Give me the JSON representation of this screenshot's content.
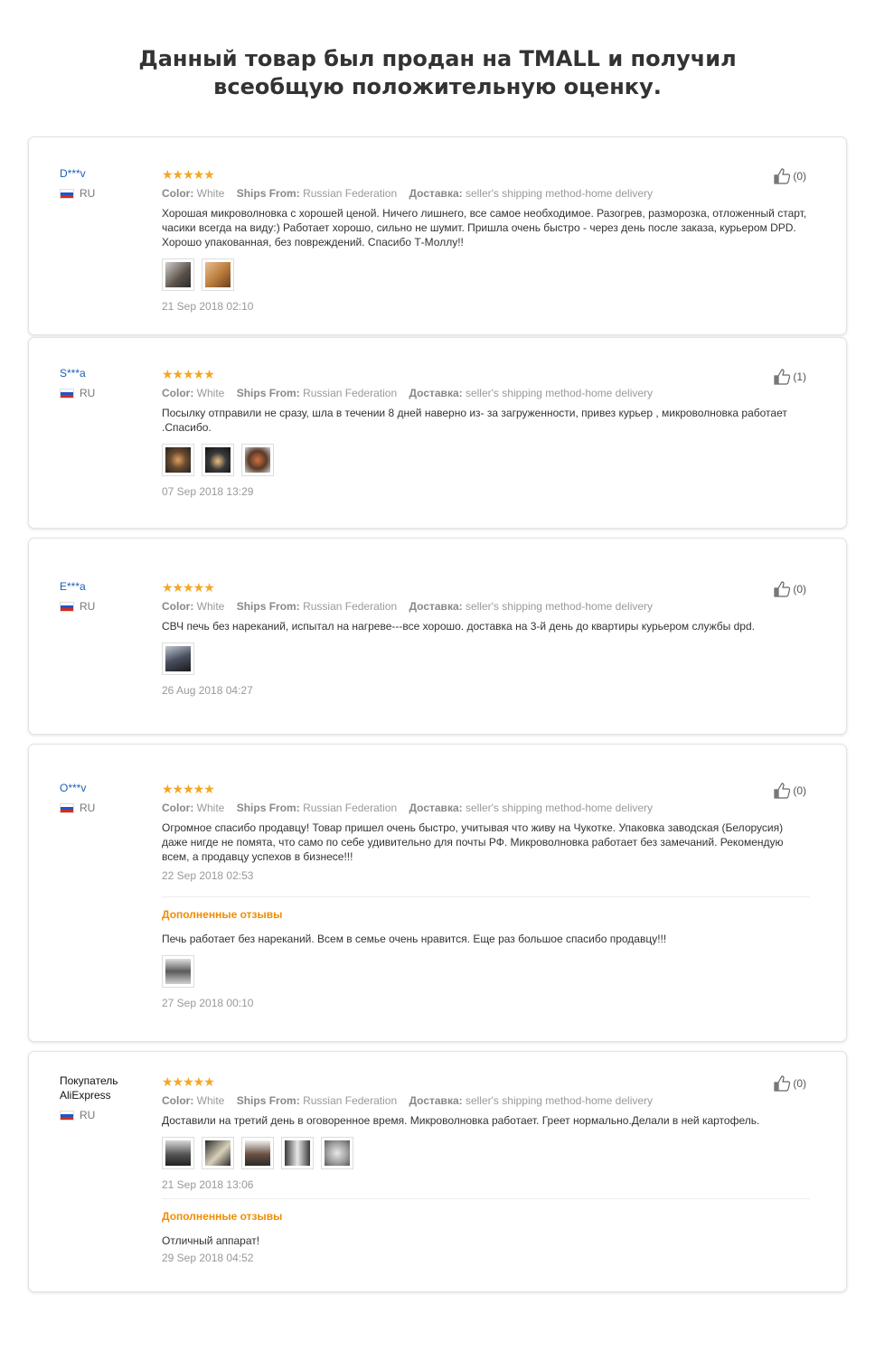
{
  "header": {
    "line1": "Данный товар был продан на TMALL и получил",
    "line2": "всеобщую положительную оценку."
  },
  "labels": {
    "color": "Color:",
    "ships_from": "Ships From:",
    "delivery": "Доставка:",
    "additional": "Дополненные отзывы"
  },
  "colors": {
    "stars": "#f5a623",
    "username": "#1a5fb4",
    "additional": "#f08c00"
  },
  "reviews": [
    {
      "user": "D***v",
      "country": "RU",
      "stars": "★★★★★",
      "rating": 5,
      "color": "White",
      "ships_from": "Russian Federation",
      "delivery": "seller's shipping method-home delivery",
      "text": "Хорошая микроволновка с хорошей ценой. Ничего лишнего, все самое необходимое. Разогрев, разморозка, отложенный старт, часики всегда на виду:) Работает хорошо, сильно не шумит. Пришла очень быстро - через день после заказа, курьером DPD. Хорошо упакованная, без повреждений. Спасибо Т-Моллу!!",
      "photos": [
        "#5a5048",
        "#b87a3a"
      ],
      "date": "21 Sep 2018 02:10",
      "likes": "(0)"
    },
    {
      "user": "S***a",
      "country": "RU",
      "stars": "★★★★★",
      "rating": 5,
      "color": "White",
      "ships_from": "Russian Federation",
      "delivery": "seller's shipping method-home delivery",
      "text": "Посылку отправили не сразу, шла в течении 8 дней наверно из- за загруженности, привез курьер , микроволновка работает .Спасибо.",
      "photos": [
        "#6a4a30",
        "#3a3a3a",
        "#5a3a28"
      ],
      "date": "07 Sep 2018 13:29",
      "likes": "(1)"
    },
    {
      "user": "E***a",
      "country": "RU",
      "stars": "★★★★★",
      "rating": 5,
      "color": "White",
      "ships_from": "Russian Federation",
      "delivery": "seller's shipping method-home delivery",
      "text": "СВЧ печь без нареканий, испытал на нагреве---все хорошо. доставка на 3-й день до квартиры курьером службы dpd.",
      "photos": [
        "#4a5060"
      ],
      "date": "26 Aug 2018 04:27",
      "likes": "(0)"
    },
    {
      "user": "O***v",
      "country": "RU",
      "stars": "★★★★★",
      "rating": 5,
      "color": "White",
      "ships_from": "Russian Federation",
      "delivery": "seller's shipping method-home delivery",
      "text": "Огромное спасибо продавцу! Товар пришел очень быстро, учитывая что живу на Чукотке. Упаковка заводская (Белорусия) даже нигде не помята, что само по себе удивительно для почты РФ. Микроволновка работает без замечаний. Рекомендую всем, а продавцу успехов в бизнесе!!!",
      "photos": [],
      "date": "22 Sep 2018 02:53",
      "likes": "(0)",
      "additional": {
        "text": "Печь работает без нареканий. Всем в семье очень нравится. Еще раз большое спасибо продавцу!!!",
        "photos": [
          "#5a5a5a"
        ],
        "date": "27 Sep 2018 00:10"
      }
    },
    {
      "user": "Покупатель AliExpress",
      "country": "RU",
      "stars": "★★★★★",
      "rating": 5,
      "color": "White",
      "ships_from": "Russian Federation",
      "delivery": "seller's shipping method-home delivery",
      "text": "Доставили на третий день в оговоренное время. Микроволновка работает. Греет нормально.Делали в ней картофель.",
      "photos": [
        "#555555",
        "#2a2a2a",
        "#6a5040",
        "#3a3a3a",
        "#9a9a9a"
      ],
      "date": "21 Sep 2018 13:06",
      "likes": "(0)",
      "additional": {
        "text": "Отличный аппарат!",
        "photos": [],
        "date": "29 Sep 2018 04:52"
      }
    }
  ]
}
